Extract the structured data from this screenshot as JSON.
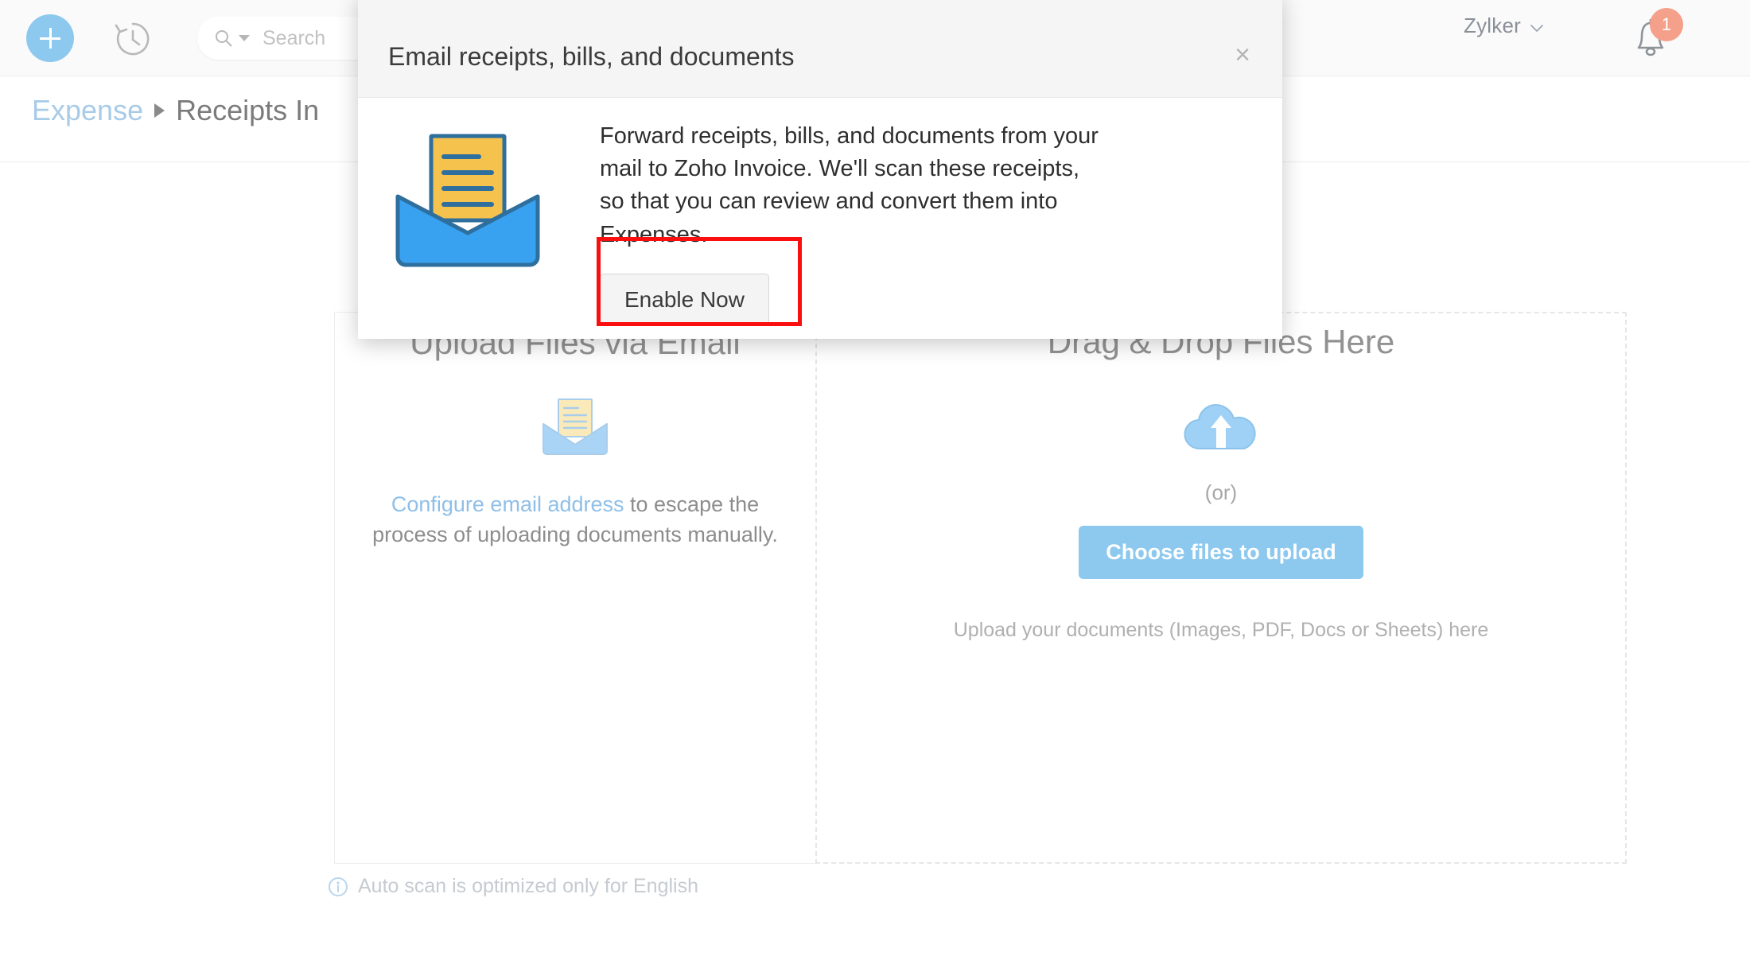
{
  "topbar": {
    "add_icon": "plus-icon",
    "history_icon": "clock-history-icon",
    "search": {
      "icon": "search-icon",
      "placeholder": "Search",
      "value": ""
    },
    "org_name": "Zylker",
    "org_caret_icon": "chevron-down-icon",
    "notifications": {
      "icon": "bell-icon",
      "count": "1",
      "badge_color": "#f4a08a"
    }
  },
  "breadcrumb": {
    "root": "Expense",
    "separator_icon": "triangle-right-icon",
    "current": "Receipts In"
  },
  "upload": {
    "email_panel": {
      "title": "Upload Files via Email",
      "icon": "open-envelope-letter-icon",
      "link_text": "Configure email address",
      "description_rest": " to escape the process of uploading documents manually."
    },
    "drop_panel": {
      "title": "Drag & Drop Files Here",
      "icon": "cloud-upload-icon",
      "or_text": "(or)",
      "choose_button": "Choose files to upload",
      "hint": "Upload your documents (Images, PDF, Docs or Sheets) here",
      "button_color": "#8dc8ee"
    }
  },
  "footnote": {
    "icon": "info-circle-icon",
    "text": "Auto scan is optimized only for English"
  },
  "modal": {
    "title": "Email receipts, bills, and documents",
    "close_icon": "close-icon",
    "illustration_icon": "open-envelope-letter-icon",
    "body_text": "Forward receipts, bills, and documents from your mail to Zoho Invoice. We'll scan these receipts, so that you can review and convert them into Expenses.",
    "primary_button": "Enable Now",
    "highlight_color": "#fb0e0e"
  }
}
